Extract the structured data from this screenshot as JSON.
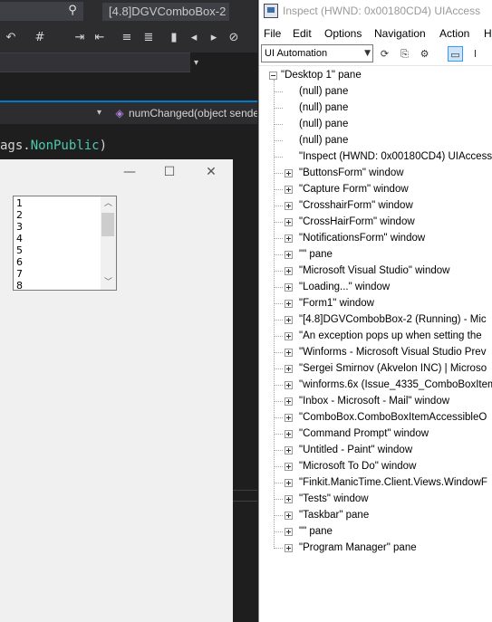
{
  "vs": {
    "title": "[4.8]DGVComboBox-2",
    "method": "numChanged(object sende",
    "code_prefix": "ags.",
    "code_member": "NonPublic",
    "code_suffix": ")"
  },
  "form1": {
    "minimize_glyph": "—",
    "maximize_glyph": "☐",
    "close_glyph": "✕",
    "listbox_items": [
      "1",
      "2",
      "3",
      "4",
      "5",
      "6",
      "7",
      "8"
    ]
  },
  "inspect": {
    "title": "Inspect  (HWND: 0x00180CD4) UIAccess",
    "menu": [
      "File",
      "Edit",
      "Options",
      "Navigation",
      "Action",
      "H"
    ],
    "mode": "UI Automation",
    "tree_root": "\"Desktop 1\" pane",
    "tree_children": [
      {
        "label": "(null) pane",
        "expandable": false
      },
      {
        "label": "(null) pane",
        "expandable": false
      },
      {
        "label": "(null) pane",
        "expandable": false
      },
      {
        "label": "(null) pane",
        "expandable": false
      },
      {
        "label": "\"Inspect  (HWND: 0x00180CD4) UIAccess",
        "expandable": false
      },
      {
        "label": "\"ButtonsForm\" window",
        "expandable": true
      },
      {
        "label": "\"Capture Form\" window",
        "expandable": true
      },
      {
        "label": "\"CrosshairForm\" window",
        "expandable": true
      },
      {
        "label": "\"CrossHairForm\" window",
        "expandable": true
      },
      {
        "label": "\"NotificationsForm\" window",
        "expandable": true
      },
      {
        "label": "\"\" pane",
        "expandable": true
      },
      {
        "label": "\"Microsoft Visual Studio\" window",
        "expandable": true
      },
      {
        "label": "\"Loading...\" window",
        "expandable": true
      },
      {
        "label": "\"Form1\" window",
        "expandable": true
      },
      {
        "label": "\"[4.8]DGVCombobBox-2 (Running) - Mic",
        "expandable": true
      },
      {
        "label": "\"An exception pops up when setting the",
        "expandable": true
      },
      {
        "label": "\"Winforms - Microsoft Visual Studio Prev",
        "expandable": true
      },
      {
        "label": "\"Sergei Smirnov (Akvelon INC) | Microso",
        "expandable": true
      },
      {
        "label": "\"winforms.6x (Issue_4335_ComboBoxItem",
        "expandable": true
      },
      {
        "label": "\"Inbox - Microsoft - Mail\" window",
        "expandable": true
      },
      {
        "label": "\"ComboBox.ComboBoxItemAccessibleO",
        "expandable": true
      },
      {
        "label": "\"Command Prompt\" window",
        "expandable": true
      },
      {
        "label": "\"Untitled - Paint\" window",
        "expandable": true
      },
      {
        "label": "\"Microsoft To Do\" window",
        "expandable": true
      },
      {
        "label": "\"Finkit.ManicTime.Client.Views.WindowF",
        "expandable": true
      },
      {
        "label": "\"Tests\" window",
        "expandable": true
      },
      {
        "label": "\"Taskbar\" pane",
        "expandable": true
      },
      {
        "label": "\"\" pane",
        "expandable": true
      },
      {
        "label": "\"Program Manager\" pane",
        "expandable": true
      }
    ]
  }
}
